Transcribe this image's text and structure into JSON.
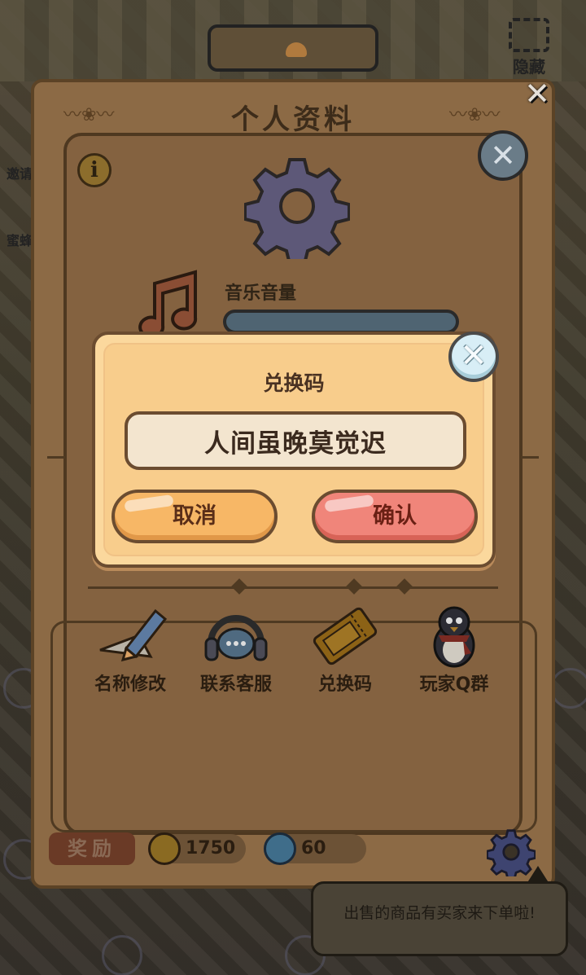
{
  "hud": {
    "hide_label": "隐藏"
  },
  "background": {
    "side_texts": [
      "邀请",
      "蜜蜂"
    ]
  },
  "panel": {
    "title": "个人资料",
    "music_label": "音乐音量",
    "info_glyph": "i",
    "actions": [
      {
        "label": "名称修改",
        "icon": "pencil-icon"
      },
      {
        "label": "联系客服",
        "icon": "headset-chat-icon"
      },
      {
        "label": "兑换码",
        "icon": "ticket-icon"
      },
      {
        "label": "玩家Q群",
        "icon": "penguin-icon"
      }
    ],
    "rewards": {
      "label": "奖励",
      "coin_amount": "1750",
      "gem_amount": "60"
    }
  },
  "dialog": {
    "title": "兑换码",
    "input_value": "人间虽晚莫觉迟",
    "cancel_label": "取消",
    "confirm_label": "确认",
    "close_glyph": "✕"
  },
  "toast": {
    "message": "出售的商品有买家来下单啦!"
  },
  "colors": {
    "dialog_bg": "#f8cd8c",
    "cancel_button": "#f7b766",
    "confirm_button": "#f0857a",
    "close_button": "#d8eef6",
    "border": "#6b4c30"
  }
}
